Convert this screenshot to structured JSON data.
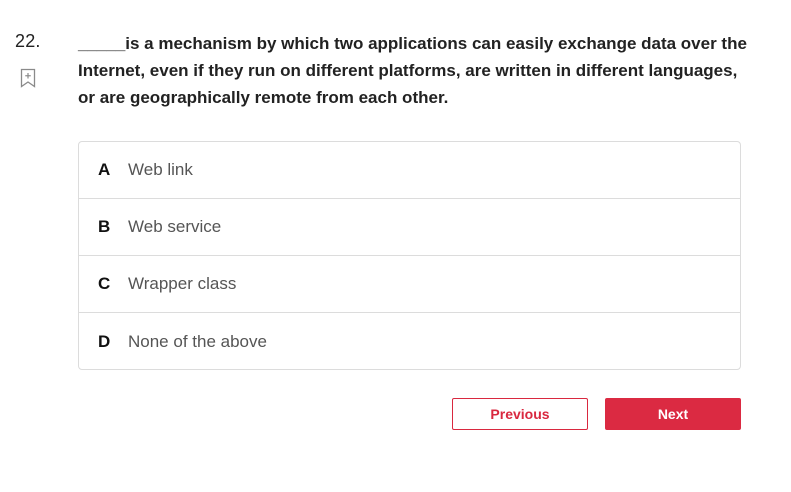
{
  "question": {
    "number": "22.",
    "text": "_____is a mechanism by which two applications can easily exchange data over the Internet, even if they run on different platforms, are written in different languages, or are geographically remote from each other."
  },
  "options": [
    {
      "letter": "A",
      "text": "Web link"
    },
    {
      "letter": "B",
      "text": "Web service"
    },
    {
      "letter": "C",
      "text": "Wrapper class"
    },
    {
      "letter": "D",
      "text": "None of the above"
    }
  ],
  "buttons": {
    "previous_label": "Previous",
    "next_label": "Next"
  },
  "icons": {
    "bookmark": "bookmark-add-icon"
  },
  "colors": {
    "accent": "#db2a42",
    "border": "#dcdcdc"
  }
}
